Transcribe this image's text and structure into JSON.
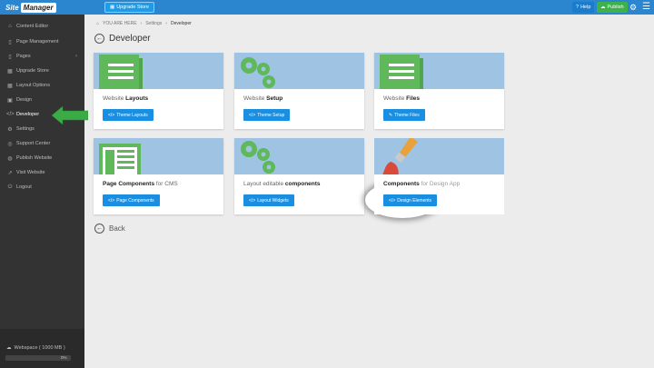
{
  "topbar": {
    "logo_part1": "Site",
    "logo_part2": "Manager",
    "upgrade_label": "Upgrade Store",
    "help_label": "Help",
    "publish_label": "Publish"
  },
  "sidebar": {
    "items": [
      {
        "label": "Content Editor",
        "icon": "home-icon"
      },
      {
        "label": "Page Management",
        "icon": "file-icon"
      },
      {
        "label": "Pages",
        "icon": "file-icon"
      },
      {
        "label": "Upgrade Store",
        "icon": "grid-icon"
      },
      {
        "label": "Layout Options",
        "icon": "grid-icon"
      },
      {
        "label": "Design",
        "icon": "image-icon"
      },
      {
        "label": "Developer",
        "icon": "code-icon"
      },
      {
        "label": "Settings",
        "icon": "gear-icon"
      },
      {
        "label": "Support Center",
        "icon": "lifebuoy-icon"
      },
      {
        "label": "Publish Website",
        "icon": "globe-icon"
      },
      {
        "label": "Visit Website",
        "icon": "external-link-icon"
      },
      {
        "label": "Logout",
        "icon": "power-icon"
      }
    ],
    "workspace_label": "Webspace ( 1000 MB )",
    "workspace_pct": "0%"
  },
  "breadcrumb": {
    "you_are_here": "YOU ARE HERE",
    "settings": "Settings",
    "current": "Developer"
  },
  "page_title": "Developer",
  "cards": [
    {
      "title_plain": "Website ",
      "title_bold": "Layouts",
      "title_suffix": "",
      "button": "Theme Layouts"
    },
    {
      "title_plain": "Website ",
      "title_bold": "Setup",
      "title_suffix": "",
      "button": "Theme Setup"
    },
    {
      "title_plain": "Website ",
      "title_bold": "Files",
      "title_suffix": "",
      "button": "Theme Files"
    },
    {
      "title_plain": "",
      "title_bold": "Page Components",
      "title_suffix": " for CMS",
      "button": "Page Components"
    },
    {
      "title_plain": "Layout editable ",
      "title_bold": "components",
      "title_suffix": "",
      "button": "Layout Widgets"
    },
    {
      "title_plain": "",
      "title_bold": "Components",
      "title_suffix": " for Design App",
      "button": "Design Elements"
    }
  ],
  "back_label": "Back",
  "colors": {
    "topbar": "#2b85cf",
    "sidebar": "#333333",
    "accent_button": "#1a8ee0",
    "publish": "#3eb24a",
    "arrow": "#3bab45",
    "card_art_bg": "#9fc4e3",
    "art_green": "#5fb85a"
  }
}
